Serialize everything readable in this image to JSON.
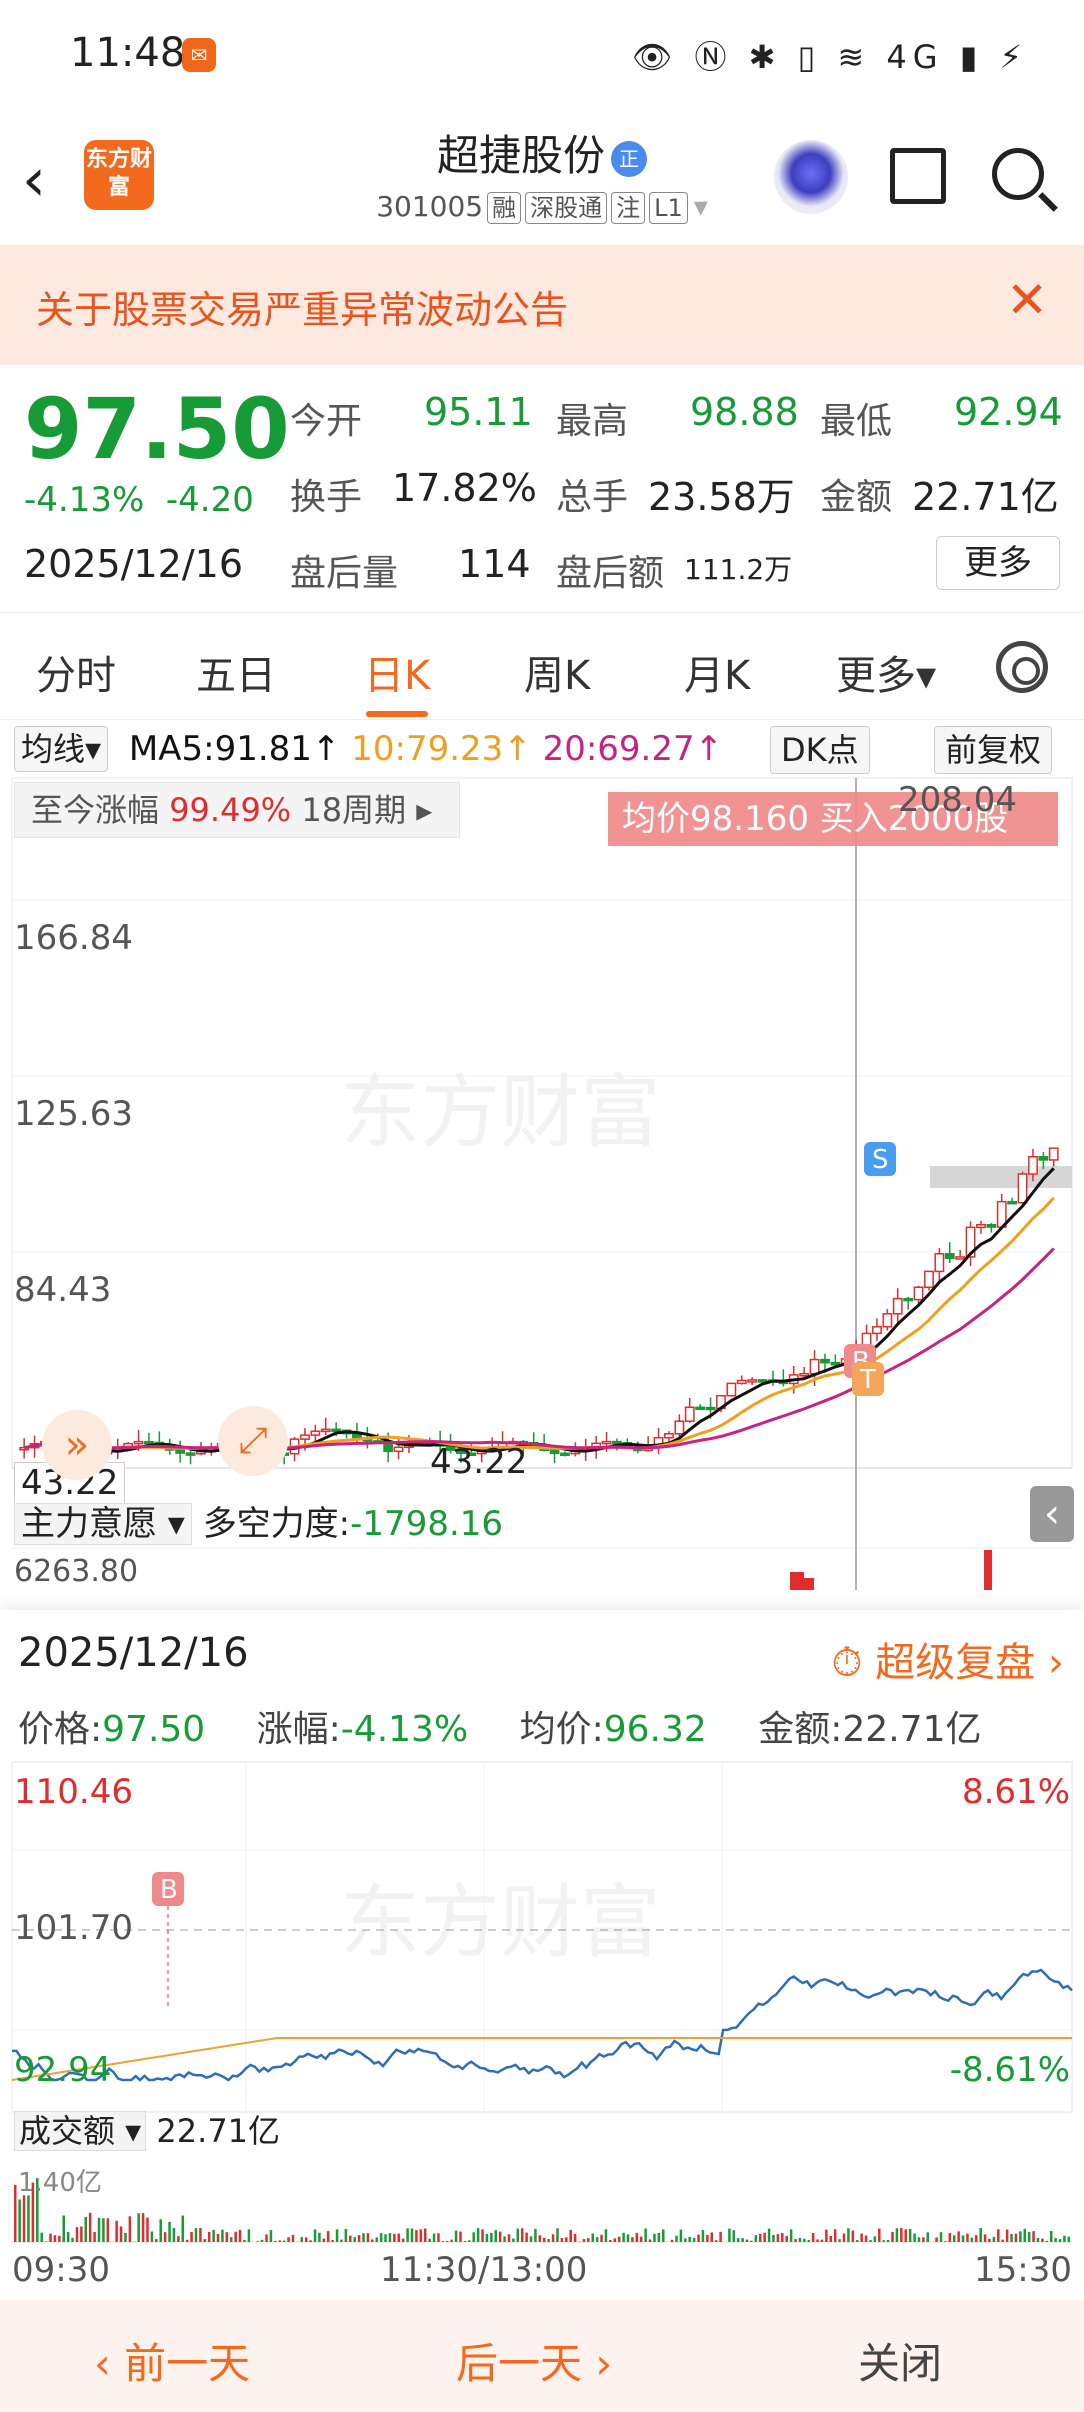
{
  "status_bar": {
    "time": "11:48",
    "icons": "👁 Ⓝ ✱ ▯ ≋ 4G ▮ ⚡"
  },
  "header": {
    "logo_text": "东方财富",
    "stock_name": "超捷股份",
    "badge": "正",
    "stock_code": "301005",
    "tags": [
      "融",
      "深股通",
      "注",
      "L1"
    ]
  },
  "notice": {
    "text": "关于股票交易严重异常波动公告",
    "close": "✕"
  },
  "quote": {
    "price": "97.50",
    "change_pct": "-4.13%",
    "change_amt": "-4.20",
    "date": "2025/12/16",
    "open_label": "今开",
    "open": "95.11",
    "high_label": "最高",
    "high": "98.88",
    "low_label": "最低",
    "low": "92.94",
    "turnover_label": "换手",
    "turnover": "17.82%",
    "volume_label": "总手",
    "volume": "23.58万",
    "amount_label": "金额",
    "amount": "22.71亿",
    "after_vol_label": "盘后量",
    "after_vol": "114",
    "after_amt_label": "盘后额",
    "after_amt": "111.2万",
    "more": "更多"
  },
  "tabs": [
    "分时",
    "五日",
    "日K",
    "周K",
    "月K",
    "更多▾"
  ],
  "kchart": {
    "ma_select": "均线▾",
    "ma5": "MA5:91.81↑",
    "ma10": "10:79.23↑",
    "ma20": "20:69.27↑",
    "dk_button": "DK点",
    "fq_button": "前复权",
    "range_label": "至今涨幅",
    "range_value": "99.49%",
    "range_period": "18周期 ▸",
    "trade_banner": "均价98.160  买入2000股",
    "y_labels": [
      "208.04",
      "166.84",
      "125.63",
      "84.43",
      "43.22"
    ],
    "low_marker": "43.22",
    "low_marker_left": "43.22",
    "indicator_select": "主力意愿 ▾",
    "indicator_name": "多空力度:",
    "indicator_value": "-1798.16",
    "indicator_scale": "6263.80",
    "watermark": "东方财富",
    "signal_s": "S",
    "signal_b": "B",
    "signal_t": "T",
    "colors": {
      "up": "#e02c2c",
      "down": "#179b36",
      "ma5": "#111111",
      "ma10": "#f0a020",
      "ma20": "#c8237e"
    }
  },
  "detail": {
    "date": "2025/12/16",
    "replay": "超级复盘 ›",
    "price_label": "价格:",
    "price": "97.50",
    "chg_label": "涨幅:",
    "chg": "-4.13%",
    "avg_label": "均价:",
    "avg": "96.32",
    "amt_label": "金额:",
    "amt": "22.71亿",
    "max_price": "110.46",
    "max_pct": "8.61%",
    "ref_price": "101.70",
    "min_price": "92.94",
    "min_pct": "-8.61%",
    "buy_marker": "B",
    "vol_select": "成交额 ▾",
    "vol_total": "22.71亿",
    "vol_scale": "1.40亿",
    "times": [
      "09:30",
      "11:30/13:00",
      "15:30"
    ]
  },
  "footer": {
    "prev": "‹ 前一天",
    "next": "后一天 ›",
    "close": "关闭"
  }
}
